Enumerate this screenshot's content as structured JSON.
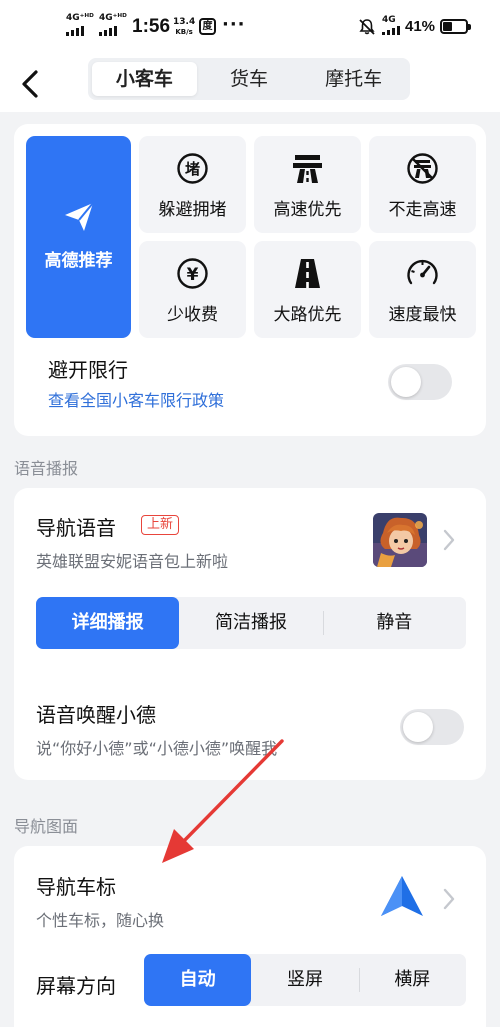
{
  "status_bar": {
    "signal_1": "4G⁺ᴴᴰ",
    "signal_2": "4G⁺ᴴᴰ",
    "time": "1:56",
    "speed_value": "13.4",
    "speed_unit": "KB/s",
    "app_icon_text": "度",
    "dots": "···",
    "network": "4G",
    "battery": "41%",
    "battery_level": 0.41
  },
  "header": {
    "tabs": [
      {
        "label": "小客车",
        "active": true
      },
      {
        "label": "货车",
        "active": false
      },
      {
        "label": "摩托车",
        "active": false
      }
    ]
  },
  "route_prefs": {
    "main": "高德推荐",
    "options": [
      {
        "label": "躲避拥堵",
        "icon": "congestion-icon",
        "glyph": "堵"
      },
      {
        "label": "高速优先",
        "icon": "highway-icon"
      },
      {
        "label": "不走高速",
        "icon": "no-highway-icon"
      },
      {
        "label": "少收费",
        "icon": "yen-icon",
        "glyph": "¥"
      },
      {
        "label": "大路优先",
        "icon": "main-road-icon"
      },
      {
        "label": "速度最快",
        "icon": "speedometer-icon"
      }
    ],
    "restrict_title": "避开限行",
    "restrict_link": "查看全国小客车限行政策",
    "restrict_enabled": false
  },
  "voice_section": {
    "label": "语音播报",
    "nav_voice_title": "导航语音",
    "nav_voice_badge": "上新",
    "nav_voice_sub": "英雄联盟安妮语音包上新啦",
    "modes": [
      {
        "label": "详细播报",
        "active": true
      },
      {
        "label": "简洁播报",
        "active": false
      },
      {
        "label": "静音",
        "active": false
      }
    ],
    "wake_title": "语音唤醒小德",
    "wake_sub": "说“你好小德”或“小德小德”唤醒我",
    "wake_enabled": false
  },
  "display_section": {
    "label": "导航图面",
    "car_icon_title": "导航车标",
    "car_icon_sub": "个性车标，随心换",
    "orientation_label": "屏幕方向",
    "orientations": [
      {
        "label": "自动",
        "active": true
      },
      {
        "label": "竖屏",
        "active": false
      },
      {
        "label": "横屏",
        "active": false
      }
    ]
  },
  "colors": {
    "accent": "#2f75f4",
    "badge_red": "#e8453c",
    "link_blue": "#2f6fd9",
    "annotation_arrow": "#e53935"
  }
}
